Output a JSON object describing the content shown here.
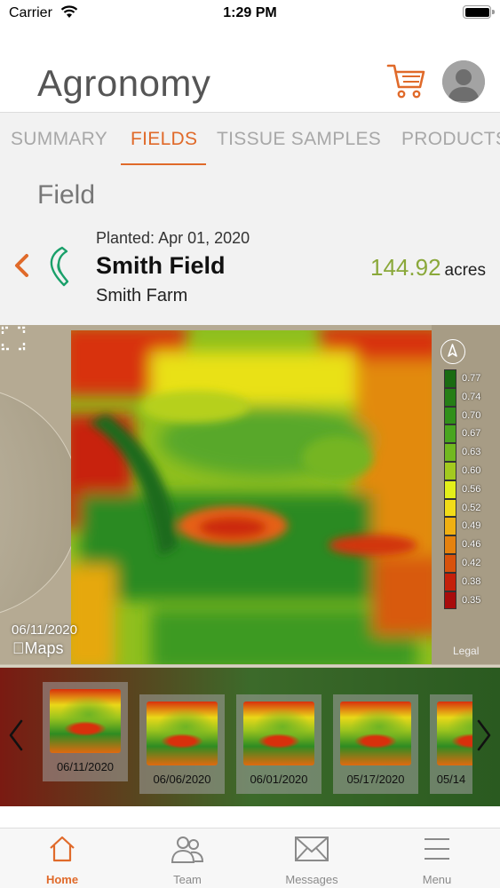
{
  "status_bar": {
    "carrier": "Carrier",
    "time": "1:29 PM"
  },
  "header": {
    "title": "Agronomy"
  },
  "tabs": [
    {
      "label": "SUMMARY"
    },
    {
      "label": "FIELDS"
    },
    {
      "label": "TISSUE SAMPLES"
    },
    {
      "label": "PRODUCTS"
    }
  ],
  "section": {
    "title": "Field"
  },
  "field": {
    "planted_label": "Planted:",
    "planted_date": "Apr 01, 2020",
    "name": "Smith Field",
    "farm": "Smith Farm",
    "acres_value": "144.92",
    "acres_unit": "acres"
  },
  "map": {
    "date": "06/11/2020",
    "maps_label": "Maps",
    "legal": "Legal",
    "legend": [
      {
        "label": "0.77",
        "color": "#1a6b12"
      },
      {
        "label": "0.74",
        "color": "#267e16"
      },
      {
        "label": "0.70",
        "color": "#31901a"
      },
      {
        "label": "0.67",
        "color": "#49a51f"
      },
      {
        "label": "0.63",
        "color": "#72b820"
      },
      {
        "label": "0.60",
        "color": "#a3c91f"
      },
      {
        "label": "0.56",
        "color": "#e3ee1a"
      },
      {
        "label": "0.52",
        "color": "#f2dc18"
      },
      {
        "label": "0.49",
        "color": "#f0b012"
      },
      {
        "label": "0.46",
        "color": "#e5820e"
      },
      {
        "label": "0.42",
        "color": "#d8520c"
      },
      {
        "label": "0.38",
        "color": "#c4200a"
      },
      {
        "label": "0.35",
        "color": "#a80c0c"
      }
    ]
  },
  "filmstrip": {
    "dates": [
      "06/11/2020",
      "06/06/2020",
      "06/01/2020",
      "05/17/2020",
      "05/14"
    ]
  },
  "tabbar": [
    {
      "label": "Home",
      "icon": "home-icon"
    },
    {
      "label": "Team",
      "icon": "team-icon"
    },
    {
      "label": "Messages",
      "icon": "envelope-icon"
    },
    {
      "label": "Menu",
      "icon": "menu-icon"
    }
  ],
  "colors": {
    "accent": "#e06a2a",
    "acres_green": "#8aa83a",
    "field_outline": "#1aa06a"
  }
}
